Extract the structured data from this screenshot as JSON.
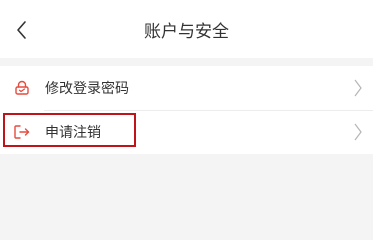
{
  "header": {
    "title": "账户与安全",
    "back_icon": "chevron-left-icon"
  },
  "menu": {
    "items": [
      {
        "label": "修改登录密码",
        "icon": "lock-icon",
        "icon_color": "#e84a3d"
      },
      {
        "label": "申请注销",
        "icon": "logout-icon",
        "icon_color": "#e84a3d"
      }
    ]
  },
  "colors": {
    "accent": "#e84a3d",
    "highlight_border": "#c0141b",
    "background": "#f4f4f4"
  }
}
